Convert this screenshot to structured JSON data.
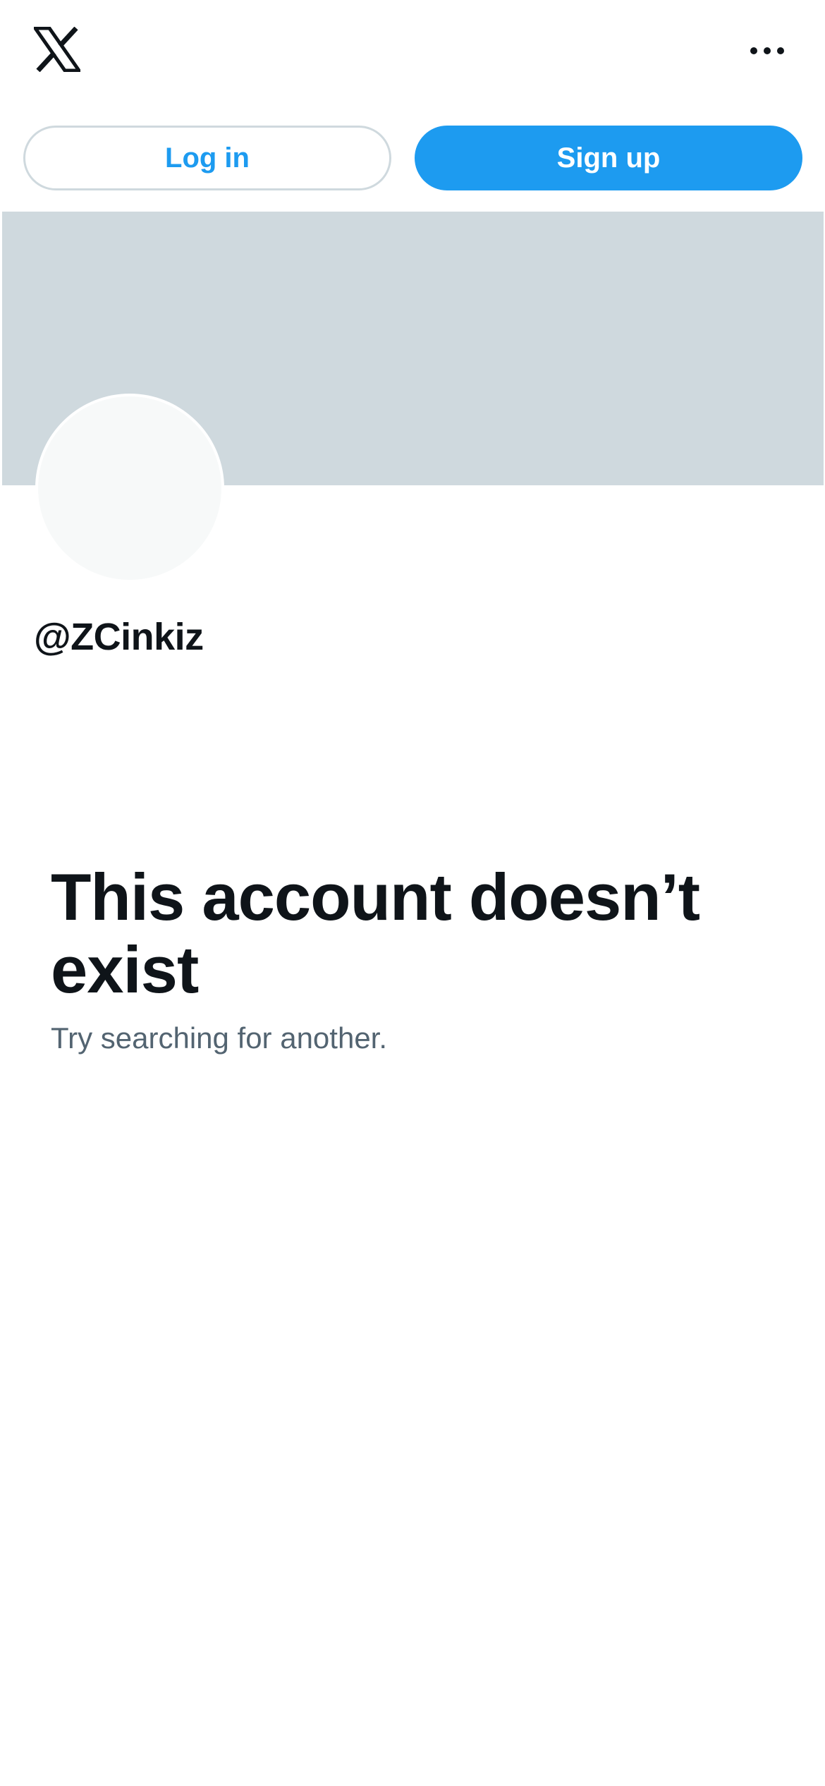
{
  "header": {
    "logo_icon": "x-logo-icon",
    "more_icon": "more-horizontal-icon"
  },
  "auth": {
    "login_label": "Log in",
    "signup_label": "Sign up"
  },
  "profile": {
    "handle": "@ZCinkiz"
  },
  "empty_state": {
    "title": "This account doesn’t exist",
    "subtitle": "Try searching for another."
  },
  "colors": {
    "accent": "#1d9bf0",
    "banner": "#cfd9de",
    "text_primary": "#0f1419",
    "text_secondary": "#536471"
  }
}
